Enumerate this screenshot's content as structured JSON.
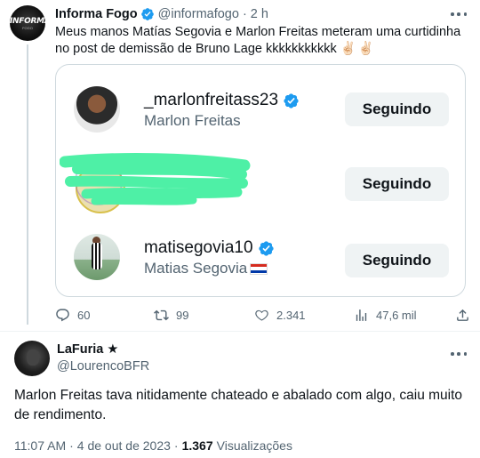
{
  "tweet": {
    "author_name": "Informa Fogo",
    "avatar_text": "INFORMA",
    "avatar_subtext": "FOGO",
    "handle": "@informafogo",
    "separator": "·",
    "time": "2 h",
    "text": "Meus manos Matías Segovia e Marlon Freitas meteram uma curtidinha no post de demissão de Bruno Lage kkkkkkkkkkk",
    "emoji": "✌🏻✌🏻",
    "card": {
      "profiles": [
        {
          "username": "_marlonfreitass23",
          "display_name": "Marlon Freitas",
          "button": "Seguindo",
          "verified": true
        },
        {
          "username": "",
          "display_name": "",
          "button": "Seguindo",
          "redacted": true
        },
        {
          "username": "matisegovia10",
          "display_name": "Matias Segovia",
          "button": "Seguindo",
          "verified": true,
          "flag": "paraguay"
        }
      ]
    },
    "actions": {
      "replies": "60",
      "retweets": "99",
      "likes": "2.341",
      "views": "47,6 mil"
    }
  },
  "reply": {
    "author_name": "LaFuria ★",
    "handle": "@LourencoBFR",
    "text": "Marlon Freitas tava nitidamente chateado e abalado com algo, caiu muito de rendimento.",
    "time": "11:07 AM",
    "separator": "·",
    "date": "4 de out de 2023",
    "separator2": "·",
    "views_count": "1.367",
    "views_label": "Visualizações"
  },
  "colors": {
    "verified_blue": "#1d9bf0",
    "secondary_text": "#536471",
    "button_bg": "#eff3f4",
    "scribble_green": "#4ef0a6"
  }
}
